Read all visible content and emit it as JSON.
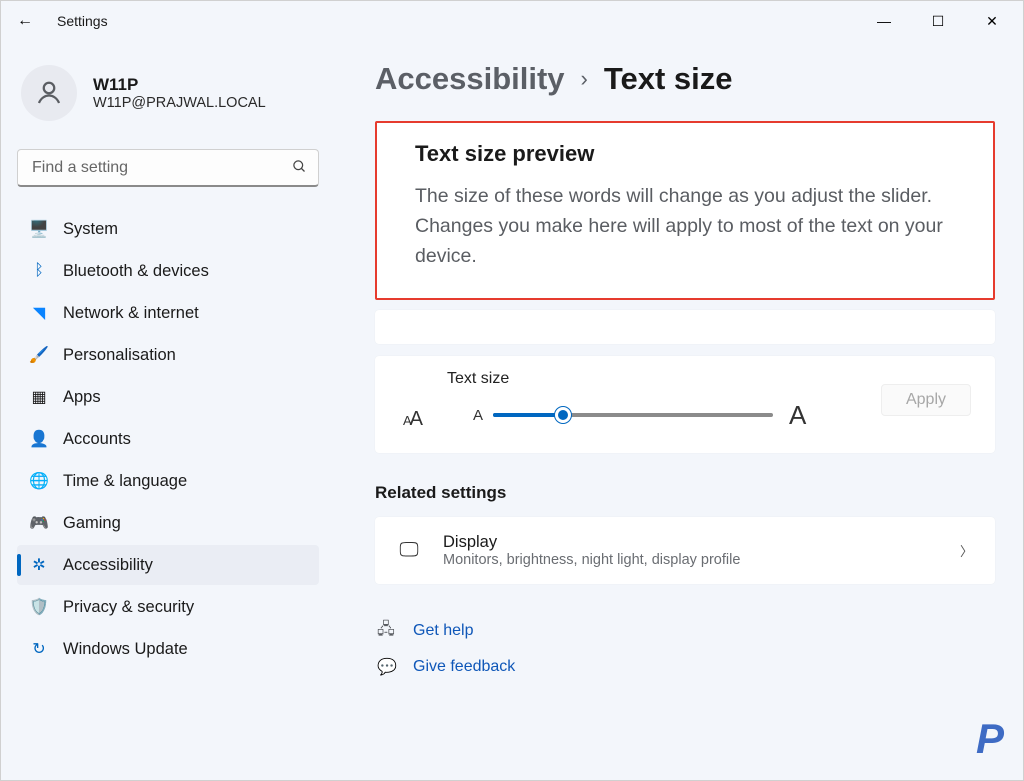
{
  "titlebar": {
    "title": "Settings"
  },
  "account": {
    "name": "W11P",
    "email": "W11P@PRAJWAL.LOCAL"
  },
  "search": {
    "placeholder": "Find a setting"
  },
  "sidebar": {
    "items": [
      {
        "label": "System"
      },
      {
        "label": "Bluetooth & devices"
      },
      {
        "label": "Network & internet"
      },
      {
        "label": "Personalisation"
      },
      {
        "label": "Apps"
      },
      {
        "label": "Accounts"
      },
      {
        "label": "Time & language"
      },
      {
        "label": "Gaming"
      },
      {
        "label": "Accessibility"
      },
      {
        "label": "Privacy & security"
      },
      {
        "label": "Windows Update"
      }
    ]
  },
  "breadcrumb": {
    "parent": "Accessibility",
    "current": "Text size"
  },
  "preview": {
    "title": "Text size preview",
    "body": "The size of these words will change as you adjust the slider. Changes you make here will apply to most of the text on your device."
  },
  "slider": {
    "label": "Text size",
    "apply_label": "Apply"
  },
  "related": {
    "heading": "Related settings",
    "display": {
      "title": "Display",
      "subtitle": "Monitors, brightness, night light, display profile"
    }
  },
  "links": {
    "get_help": "Get help",
    "give_feedback": "Give feedback"
  },
  "watermark": "P"
}
